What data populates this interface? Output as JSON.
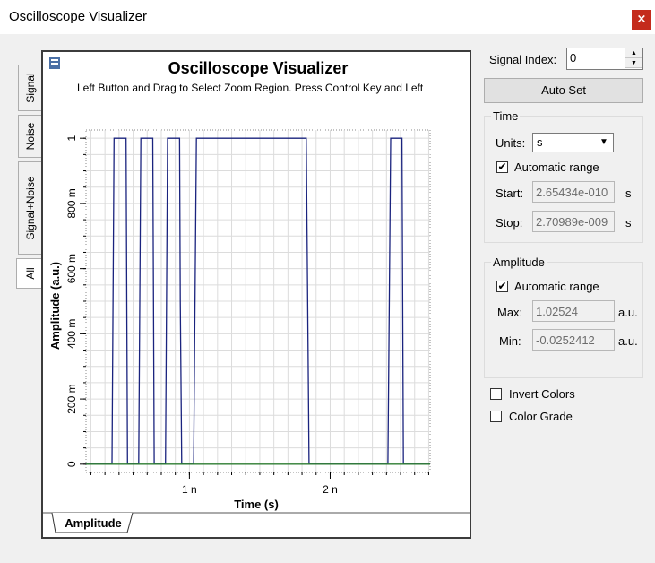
{
  "window": {
    "title": "Oscilloscope Visualizer",
    "close": "×"
  },
  "tabs": [
    {
      "label": "Signal"
    },
    {
      "label": "Noise"
    },
    {
      "label": "Signal+Noise"
    },
    {
      "label": "All"
    }
  ],
  "plot": {
    "title": "Oscilloscope Visualizer",
    "hint": "Left Button and Drag to Select Zoom Region. Press Control Key and Left",
    "bottom_tab": "Amplitude"
  },
  "controls": {
    "signal_index_label": "Signal Index:",
    "signal_index_value": "0",
    "auto_set": "Auto Set",
    "time": {
      "title": "Time",
      "units_label": "Units:",
      "units_value": "s",
      "auto_range": "Automatic range",
      "start_label": "Start:",
      "start_value": "2.65434e-010",
      "start_unit": "s",
      "stop_label": "Stop:",
      "stop_value": "2.70989e-009",
      "stop_unit": "s"
    },
    "amplitude": {
      "title": "Amplitude",
      "auto_range": "Automatic range",
      "max_label": "Max:",
      "max_value": "1.02524",
      "max_unit": "a.u.",
      "min_label": "Min:",
      "min_value": "-0.0252412",
      "min_unit": "a.u."
    },
    "invert_colors": "Invert Colors",
    "color_grade": "Color Grade",
    "checkmark": "✔"
  },
  "chart_data": {
    "type": "line",
    "xlabel": "Time (s)",
    "ylabel": "Amplitude (a.u.)",
    "xlim": [
      0.265434,
      2.70989
    ],
    "ylim": [
      -0.0252412,
      1.02524
    ],
    "x_unit_note": "x values in ns",
    "x_ticks": [
      {
        "value": 1.0,
        "label": "1 n"
      },
      {
        "value": 2.0,
        "label": "2 n"
      }
    ],
    "y_ticks": [
      {
        "value": 0,
        "label": "0"
      },
      {
        "value": 0.2,
        "label": "200 m"
      },
      {
        "value": 0.4,
        "label": "400 m"
      },
      {
        "value": 0.6,
        "label": "600 m"
      },
      {
        "value": 0.8,
        "label": "800 m"
      },
      {
        "value": 1.0,
        "label": "1"
      }
    ],
    "grid": true,
    "series": [
      {
        "color": "#1a237e",
        "x": [
          0.265,
          0.45,
          0.465,
          0.55,
          0.56,
          0.64,
          0.655,
          0.74,
          0.75,
          0.83,
          0.845,
          0.93,
          0.935,
          0.945,
          0.96,
          1.03,
          1.05,
          1.83,
          1.85,
          2.41,
          2.43,
          2.51,
          2.52,
          2.71
        ],
        "y": [
          0,
          0,
          1,
          1,
          0,
          0,
          1,
          1,
          0,
          0,
          1,
          1,
          0.5,
          0,
          0,
          0,
          1,
          1,
          0,
          0,
          1,
          1,
          0,
          0
        ]
      },
      {
        "color": "#2e7d32",
        "x": [
          0.265,
          2.71
        ],
        "y": [
          0,
          0
        ]
      }
    ]
  }
}
